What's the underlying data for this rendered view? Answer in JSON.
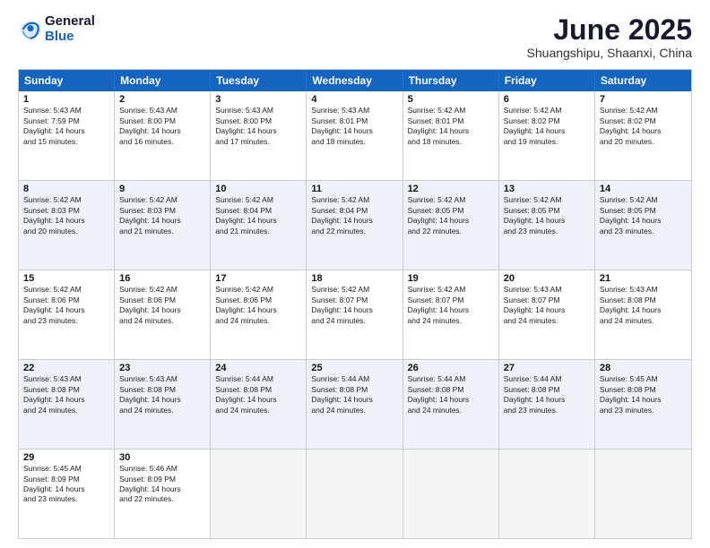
{
  "logo": {
    "line1": "General",
    "line2": "Blue"
  },
  "title": "June 2025",
  "location": "Shuangshipu, Shaanxi, China",
  "days_of_week": [
    "Sunday",
    "Monday",
    "Tuesday",
    "Wednesday",
    "Thursday",
    "Friday",
    "Saturday"
  ],
  "weeks": [
    [
      {
        "day": "1",
        "text": "Sunrise: 5:43 AM\nSunset: 7:59 PM\nDaylight: 14 hours\nand 15 minutes."
      },
      {
        "day": "2",
        "text": "Sunrise: 5:43 AM\nSunset: 8:00 PM\nDaylight: 14 hours\nand 16 minutes."
      },
      {
        "day": "3",
        "text": "Sunrise: 5:43 AM\nSunset: 8:00 PM\nDaylight: 14 hours\nand 17 minutes."
      },
      {
        "day": "4",
        "text": "Sunrise: 5:43 AM\nSunset: 8:01 PM\nDaylight: 14 hours\nand 18 minutes."
      },
      {
        "day": "5",
        "text": "Sunrise: 5:42 AM\nSunset: 8:01 PM\nDaylight: 14 hours\nand 18 minutes."
      },
      {
        "day": "6",
        "text": "Sunrise: 5:42 AM\nSunset: 8:02 PM\nDaylight: 14 hours\nand 19 minutes."
      },
      {
        "day": "7",
        "text": "Sunrise: 5:42 AM\nSunset: 8:02 PM\nDaylight: 14 hours\nand 20 minutes."
      }
    ],
    [
      {
        "day": "8",
        "text": "Sunrise: 5:42 AM\nSunset: 8:03 PM\nDaylight: 14 hours\nand 20 minutes."
      },
      {
        "day": "9",
        "text": "Sunrise: 5:42 AM\nSunset: 8:03 PM\nDaylight: 14 hours\nand 21 minutes."
      },
      {
        "day": "10",
        "text": "Sunrise: 5:42 AM\nSunset: 8:04 PM\nDaylight: 14 hours\nand 21 minutes."
      },
      {
        "day": "11",
        "text": "Sunrise: 5:42 AM\nSunset: 8:04 PM\nDaylight: 14 hours\nand 22 minutes."
      },
      {
        "day": "12",
        "text": "Sunrise: 5:42 AM\nSunset: 8:05 PM\nDaylight: 14 hours\nand 22 minutes."
      },
      {
        "day": "13",
        "text": "Sunrise: 5:42 AM\nSunset: 8:05 PM\nDaylight: 14 hours\nand 23 minutes."
      },
      {
        "day": "14",
        "text": "Sunrise: 5:42 AM\nSunset: 8:05 PM\nDaylight: 14 hours\nand 23 minutes."
      }
    ],
    [
      {
        "day": "15",
        "text": "Sunrise: 5:42 AM\nSunset: 8:06 PM\nDaylight: 14 hours\nand 23 minutes."
      },
      {
        "day": "16",
        "text": "Sunrise: 5:42 AM\nSunset: 8:06 PM\nDaylight: 14 hours\nand 24 minutes."
      },
      {
        "day": "17",
        "text": "Sunrise: 5:42 AM\nSunset: 8:06 PM\nDaylight: 14 hours\nand 24 minutes."
      },
      {
        "day": "18",
        "text": "Sunrise: 5:42 AM\nSunset: 8:07 PM\nDaylight: 14 hours\nand 24 minutes."
      },
      {
        "day": "19",
        "text": "Sunrise: 5:42 AM\nSunset: 8:07 PM\nDaylight: 14 hours\nand 24 minutes."
      },
      {
        "day": "20",
        "text": "Sunrise: 5:43 AM\nSunset: 8:07 PM\nDaylight: 14 hours\nand 24 minutes."
      },
      {
        "day": "21",
        "text": "Sunrise: 5:43 AM\nSunset: 8:08 PM\nDaylight: 14 hours\nand 24 minutes."
      }
    ],
    [
      {
        "day": "22",
        "text": "Sunrise: 5:43 AM\nSunset: 8:08 PM\nDaylight: 14 hours\nand 24 minutes."
      },
      {
        "day": "23",
        "text": "Sunrise: 5:43 AM\nSunset: 8:08 PM\nDaylight: 14 hours\nand 24 minutes."
      },
      {
        "day": "24",
        "text": "Sunrise: 5:44 AM\nSunset: 8:08 PM\nDaylight: 14 hours\nand 24 minutes."
      },
      {
        "day": "25",
        "text": "Sunrise: 5:44 AM\nSunset: 8:08 PM\nDaylight: 14 hours\nand 24 minutes."
      },
      {
        "day": "26",
        "text": "Sunrise: 5:44 AM\nSunset: 8:08 PM\nDaylight: 14 hours\nand 24 minutes."
      },
      {
        "day": "27",
        "text": "Sunrise: 5:44 AM\nSunset: 8:08 PM\nDaylight: 14 hours\nand 23 minutes."
      },
      {
        "day": "28",
        "text": "Sunrise: 5:45 AM\nSunset: 8:08 PM\nDaylight: 14 hours\nand 23 minutes."
      }
    ],
    [
      {
        "day": "29",
        "text": "Sunrise: 5:45 AM\nSunset: 8:09 PM\nDaylight: 14 hours\nand 23 minutes."
      },
      {
        "day": "30",
        "text": "Sunrise: 5:46 AM\nSunset: 8:09 PM\nDaylight: 14 hours\nand 22 minutes."
      },
      {
        "day": "",
        "text": ""
      },
      {
        "day": "",
        "text": ""
      },
      {
        "day": "",
        "text": ""
      },
      {
        "day": "",
        "text": ""
      },
      {
        "day": "",
        "text": ""
      }
    ]
  ]
}
